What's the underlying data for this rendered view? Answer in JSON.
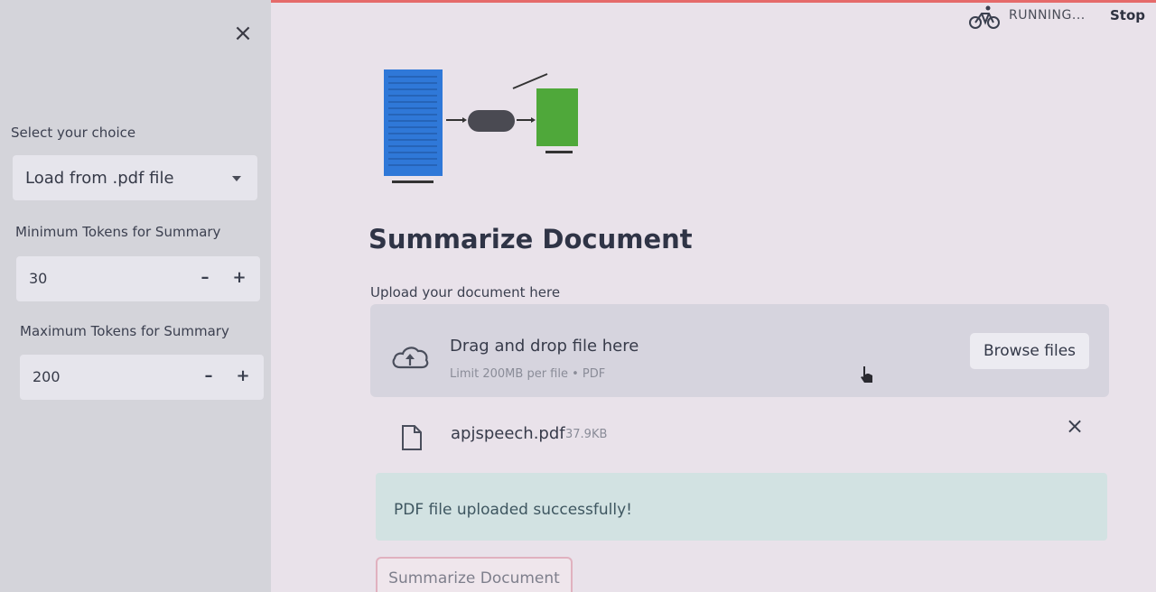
{
  "sidebar": {
    "close_symbol": "×",
    "choice_label": "Select your choice",
    "choice_value": "Load from .pdf file",
    "min_tokens_label": "Minimum Tokens for Summary",
    "min_tokens_value": "30",
    "max_tokens_label": "Maximum Tokens for Summary",
    "max_tokens_value": "200",
    "minus_symbol": "–",
    "plus_symbol": "+"
  },
  "header": {
    "status_text": "RUNNING...",
    "stop_label": "Stop",
    "status_icon": "bicycle-icon"
  },
  "main": {
    "title": "Summarize Document",
    "upload_label": "Upload your document here",
    "dropzone": {
      "main_text": "Drag and drop file here",
      "sub_text": "Limit 200MB per file • PDF",
      "browse_label": "Browse files",
      "icon": "cloud-upload-icon"
    },
    "uploaded_file": {
      "name": "apjspeech.pdf",
      "size": "37.9KB",
      "remove_symbol": "×",
      "icon": "file-icon"
    },
    "success_message": "PDF file uploaded successfully!",
    "summarize_button_label": "Summarize Document"
  },
  "colors": {
    "background": "#e9e2ea",
    "sidebar": "#d4d4da",
    "success_bg": "#d2e2e2",
    "doc_blue": "#2f78d8",
    "summary_green": "#4fa83a",
    "button_border": "#e0b1bf"
  }
}
